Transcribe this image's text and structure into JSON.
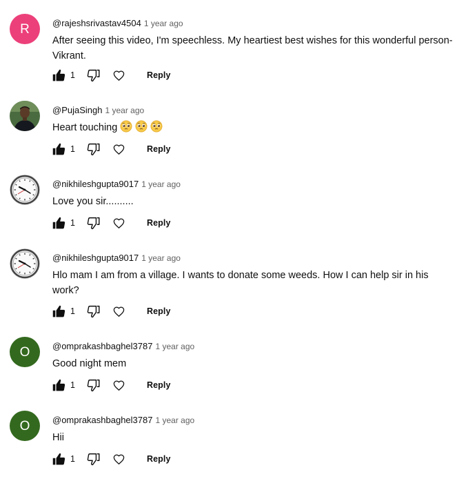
{
  "comments": [
    {
      "author": "@rajeshsrivastav4504",
      "time": "1 year ago",
      "text": "After seeing this video, I'm speechless. My heartiest best wishes for this wonderful person-Vikrant.",
      "likes": "1",
      "reply_label": "Reply",
      "avatar": {
        "type": "letter",
        "letter": "R",
        "color": "#ec407a"
      }
    },
    {
      "author": "@PujaSingh",
      "time": "1 year ago",
      "text": "Heart touching",
      "emojis": [
        "pleading-face-emoji",
        "pleading-face-emoji",
        "pleading-face-emoji"
      ],
      "likes": "1",
      "reply_label": "Reply",
      "avatar": {
        "type": "photo",
        "icon": "person-photo-avatar"
      }
    },
    {
      "author": "@nikhileshgupta9017",
      "time": "1 year ago",
      "text": "Love you sir..........",
      "likes": "1",
      "reply_label": "Reply",
      "avatar": {
        "type": "clock",
        "icon": "clock-avatar"
      }
    },
    {
      "author": "@nikhileshgupta9017",
      "time": "1 year ago",
      "text": "Hlo mam I am from a village. I wants to donate some weeds. How I can help sir in his work?",
      "likes": "1",
      "reply_label": "Reply",
      "avatar": {
        "type": "clock",
        "icon": "clock-avatar"
      }
    },
    {
      "author": "@omprakashbaghel3787",
      "time": "1 year ago",
      "text": "Good night  mem",
      "likes": "1",
      "reply_label": "Reply",
      "avatar": {
        "type": "letter",
        "letter": "O",
        "color": "#33691e"
      }
    },
    {
      "author": "@omprakashbaghel3787",
      "time": "1 year ago",
      "text": "Hii",
      "likes": "1",
      "reply_label": "Reply",
      "avatar": {
        "type": "letter",
        "letter": "O",
        "color": "#33691e"
      }
    }
  ],
  "icons": {
    "like": "thumbs-up-icon",
    "dislike": "thumbs-down-icon",
    "heart": "heart-icon"
  },
  "colors": {
    "text": "#0f0f0f",
    "secondary": "#606060"
  }
}
